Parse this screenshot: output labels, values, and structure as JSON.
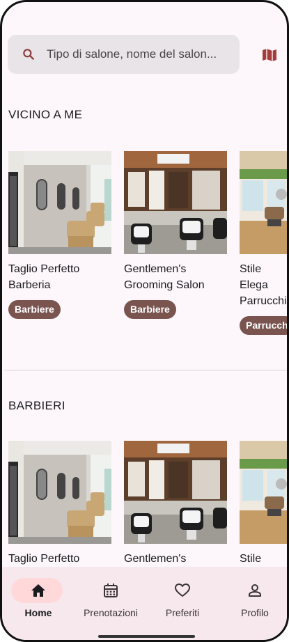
{
  "search": {
    "placeholder": "Tipo di salone, nome del salon..."
  },
  "icons": {
    "search": "search-icon",
    "map": "map-icon"
  },
  "sections": [
    {
      "title": "VICINO A ME",
      "cards": [
        {
          "name": "Taglio Perfetto\nBarberia",
          "tag": "Barbiere"
        },
        {
          "name": "Gentlemen's\nGrooming Salon",
          "tag": "Barbiere"
        },
        {
          "name": "Stile Elega\nParrucchi",
          "tag": "Parrucch"
        }
      ]
    },
    {
      "title": "BARBIERI",
      "cards": [
        {
          "name": "Taglio Perfetto",
          "tag": ""
        },
        {
          "name": "Gentlemen's",
          "tag": ""
        },
        {
          "name": "Stile Elega",
          "tag": ""
        }
      ]
    }
  ],
  "nav": [
    {
      "label": "Home",
      "icon": "home-icon",
      "active": true
    },
    {
      "label": "Prenotazioni",
      "icon": "calendar-icon",
      "active": false
    },
    {
      "label": "Preferiti",
      "icon": "heart-icon",
      "active": false
    },
    {
      "label": "Profilo",
      "icon": "person-icon",
      "active": false
    }
  ],
  "colors": {
    "accent": "#7a5550",
    "nav_bg": "#f6e8ec",
    "active_pill": "#ffd9da",
    "page_bg": "#fdf7fb"
  }
}
